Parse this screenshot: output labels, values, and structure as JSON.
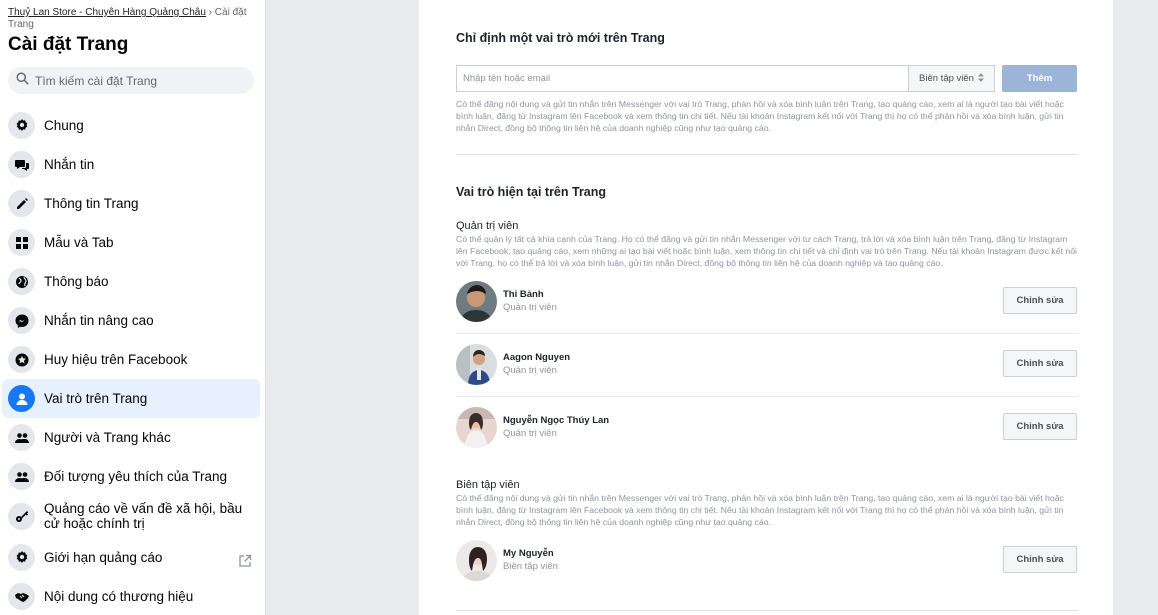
{
  "sidebar": {
    "breadcrumb_link": "Thuỷ Lan Store - Chuyên Hàng Quảng Châu",
    "breadcrumb_sep": " › ",
    "breadcrumb_current": "Cài đặt Trang",
    "title": "Cài đặt Trang",
    "search_placeholder": "Tìm kiếm cài đặt Trang",
    "active_color": "#1877f2",
    "items": [
      {
        "label": "Chung",
        "icon": "gear-icon"
      },
      {
        "label": "Nhắn tin",
        "icon": "chat-bubbles-icon"
      },
      {
        "label": "Thông tin Trang",
        "icon": "pencil-icon"
      },
      {
        "label": "Mẫu và Tab",
        "icon": "grid-icon"
      },
      {
        "label": "Thông báo",
        "icon": "globe-icon"
      },
      {
        "label": "Nhắn tin nâng cao",
        "icon": "messenger-icon"
      },
      {
        "label": "Huy hiệu trên Facebook",
        "icon": "star-badge-icon"
      },
      {
        "label": "Vai trò trên Trang",
        "icon": "person-icon",
        "active": true
      },
      {
        "label": "Người và Trang khác",
        "icon": "people-icon"
      },
      {
        "label": "Đối tượng yêu thích của Trang",
        "icon": "people-icon"
      },
      {
        "label": "Quảng cáo về vấn đề xã hội, bầu cử hoặc chính trị",
        "icon": "key-icon"
      },
      {
        "label": "Giới hạn quảng cáo",
        "icon": "gear-icon",
        "external_icon": "external-link-icon"
      },
      {
        "label": "Nội dung có thương hiệu",
        "icon": "handshake-icon"
      }
    ]
  },
  "main": {
    "assign": {
      "title": "Chỉ định một vai trò mới trên Trang",
      "input_placeholder": "Nhập tên hoặc email",
      "role_select": "Biên tập viên",
      "add_label": "Thêm",
      "description": "Có thể đăng nội dung và gửi tin nhắn trên Messenger với vai trò Trang, phản hồi và xóa bình luận trên Trang, tạo quảng cáo, xem ai là người tạo bài viết hoặc bình luận, đăng từ Instagram lên Facebook và xem thông tin chi tiết. Nếu tài khoản Instagram kết nối với Trang thì họ có thể phản hồi và xóa bình luận, gửi tin nhắn Direct, đồng bộ thông tin liên hệ của doanh nghiệp cũng như tạo quảng cáo."
    },
    "current": {
      "title": "Vai trò hiện tại trên Trang",
      "edit_label": "Chỉnh sửa",
      "groups": [
        {
          "title": "Quản trị viên",
          "description": "Có thể quản lý tất cả khía cạnh của Trang. Họ có thể đăng và gửi tin nhắn Messenger với tư cách Trang, trả lời và xóa bình luận trên Trang, đăng từ Instagram lên Facebook, tạo quảng cáo, xem những ai tạo bài viết hoặc bình luận, xem thông tin chi tiết và chỉ định vai trò trên Trang. Nếu tài khoản Instagram được kết nối với Trang, họ có thể trả lời và xóa bình luận, gửi tin nhắn Direct, đồng bộ thông tin liên hệ của doanh nghiệp và tạo quảng cáo.",
          "people": [
            {
              "name": "Thi Bảnh",
              "role": "Quản trị viên"
            },
            {
              "name": "Aagon Nguyen",
              "role": "Quản trị viên"
            },
            {
              "name": "Nguyễn Ngọc Thúy Lan",
              "role": "Quản trị viên"
            }
          ]
        },
        {
          "title": "Biên tập viên",
          "description": "Có thể đăng nội dung và gửi tin nhắn trên Messenger với vai trò Trang, phản hồi và xóa bình luận trên Trang, tạo quảng cáo, xem ai là người tạo bài viết hoặc bình luận, đăng từ Instagram lên Facebook và xem thông tin chi tiết. Nếu tài khoản Instagram kết nối với Trang thì họ có thể phản hồi và xóa bình luận, gửi tin nhắn Direct, đồng bộ thông tin liên hệ của doanh nghiệp cũng như tạo quảng cáo.",
          "people": [
            {
              "name": "My Nguyễn",
              "role": "Biên tập viên"
            }
          ]
        }
      ]
    }
  }
}
